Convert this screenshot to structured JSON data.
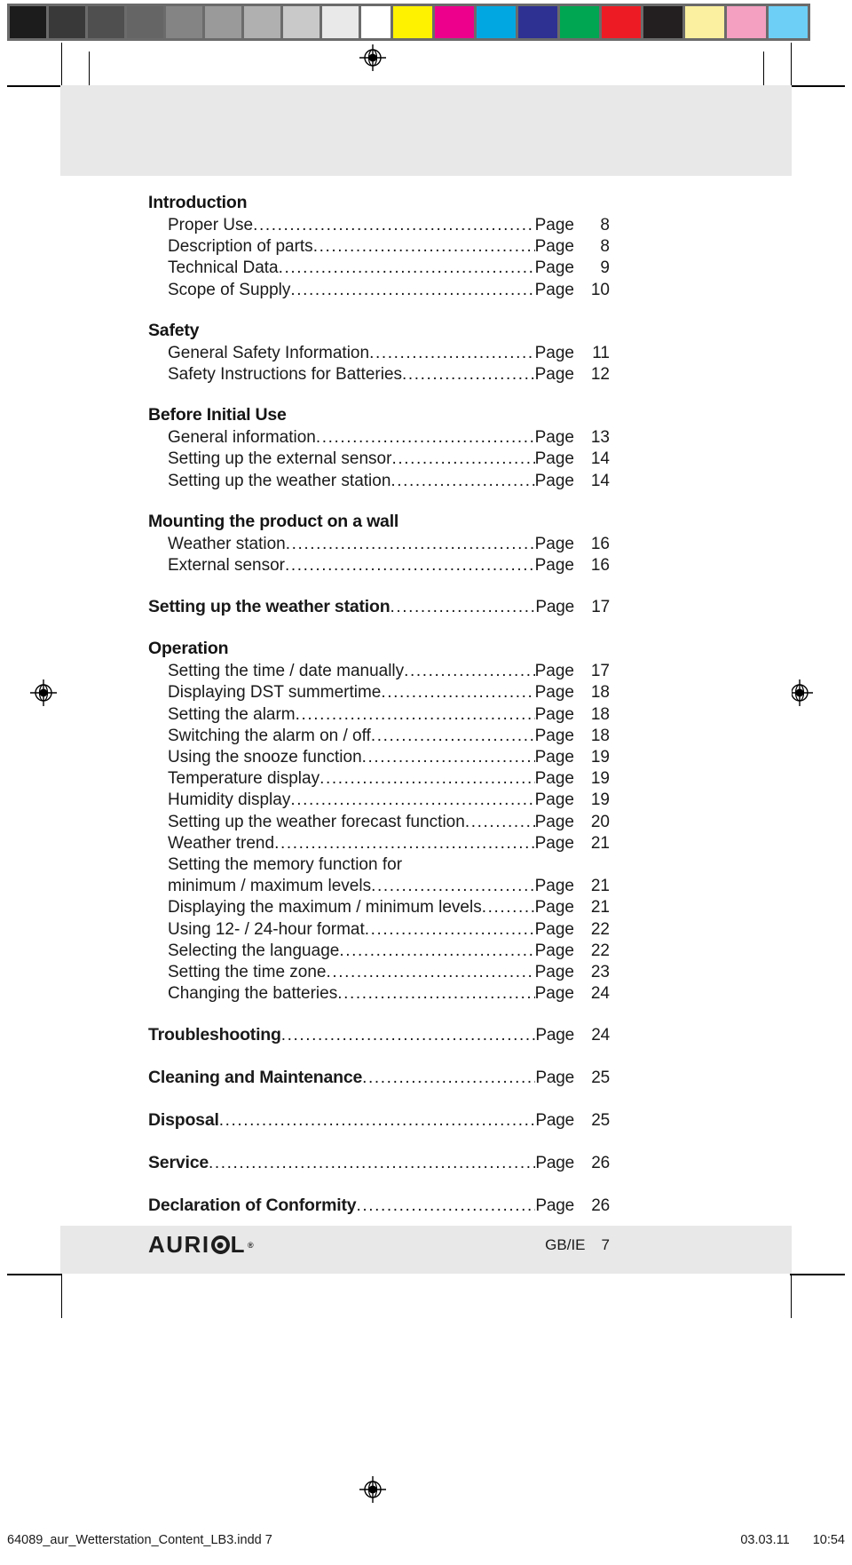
{
  "calibration": {
    "grayscale_patches": [
      "#1c1c1c",
      "#393939",
      "#4f4f4f",
      "#656565",
      "#848484",
      "#9a9a9a",
      "#b0b0b0",
      "#c9c9c9",
      "#e9e9e9",
      "#ffffff"
    ],
    "color_patches": [
      "#fff200",
      "#ec008c",
      "#00a7e1",
      "#2e3192",
      "#00a651",
      "#ed1c24",
      "#231f20",
      "#fbf0a0",
      "#f4a0c0",
      "#6dcff6"
    ],
    "strip_background": "#6b6b6b"
  },
  "toc": {
    "sections": [
      {
        "heading": "Introduction",
        "entries": [
          {
            "label": "Proper Use",
            "page_word": "Page",
            "page": "8"
          },
          {
            "label": "Description of parts",
            "page_word": "Page",
            "page": "8"
          },
          {
            "label": "Technical Data",
            "page_word": "Page",
            "page": "9"
          },
          {
            "label": "Scope of Supply",
            "page_word": "Page",
            "page": "10"
          }
        ]
      },
      {
        "heading": "Safety",
        "entries": [
          {
            "label": "General Safety Information",
            "page_word": "Page",
            "page": "11"
          },
          {
            "label": "Safety Instructions for Batteries",
            "page_word": "Page",
            "page": "12"
          }
        ]
      },
      {
        "heading": "Before Initial Use",
        "entries": [
          {
            "label": "General information",
            "page_word": "Page",
            "page": "13"
          },
          {
            "label": "Setting up the external sensor",
            "page_word": "Page",
            "page": "14"
          },
          {
            "label": "Setting up the weather station",
            "page_word": "Page",
            "page": "14"
          }
        ]
      },
      {
        "heading": "Mounting the product on a wall",
        "entries": [
          {
            "label": "Weather station",
            "page_word": "Page",
            "page": "16"
          },
          {
            "label": "External sensor",
            "page_word": "Page",
            "page": "16"
          }
        ]
      },
      {
        "heading_row": {
          "label": "Setting up the weather station",
          "page_word": "Page",
          "page": "17"
        },
        "entries": []
      },
      {
        "heading": "Operation",
        "entries": [
          {
            "label": "Setting the time / date manually",
            "page_word": "Page",
            "page": "17"
          },
          {
            "label": "Displaying DST summertime",
            "page_word": "Page",
            "page": "18"
          },
          {
            "label": "Setting the alarm",
            "page_word": "Page",
            "page": "18"
          },
          {
            "label": "Switching the alarm on / off",
            "page_word": "Page",
            "page": "18"
          },
          {
            "label": "Using the snooze function",
            "page_word": "Page",
            "page": "19"
          },
          {
            "label": "Temperature display",
            "page_word": "Page",
            "page": "19"
          },
          {
            "label": "Humidity display",
            "page_word": "Page",
            "page": "19"
          },
          {
            "label": "Setting up the weather forecast function",
            "page_word": "Page",
            "page": "20"
          },
          {
            "label": "Weather trend",
            "page_word": "Page",
            "page": "21"
          },
          {
            "label": "Setting the memory function for",
            "continuation": true
          },
          {
            "label": "minimum / maximum levels",
            "page_word": "Page",
            "page": "21"
          },
          {
            "label": "Displaying the maximum / minimum levels",
            "page_word": "Page",
            "page": "21"
          },
          {
            "label": "Using 12- / 24-hour format",
            "page_word": "Page",
            "page": "22"
          },
          {
            "label": "Selecting the language",
            "page_word": "Page",
            "page": "22"
          },
          {
            "label": "Setting the time zone",
            "page_word": "Page",
            "page": "23"
          },
          {
            "label": "Changing the batteries",
            "page_word": "Page",
            "page": "24"
          }
        ]
      },
      {
        "heading_row": {
          "label": "Troubleshooting",
          "page_word": "Page",
          "page": "24"
        },
        "entries": []
      },
      {
        "heading_row": {
          "label": "Cleaning and Maintenance",
          "page_word": "Page",
          "page": "25"
        },
        "entries": []
      },
      {
        "heading_row": {
          "label": "Disposal",
          "page_word": "Page",
          "page": "25"
        },
        "entries": []
      },
      {
        "heading_row": {
          "label": "Service",
          "page_word": "Page",
          "page": "26"
        },
        "entries": []
      },
      {
        "heading_row": {
          "label": "Declaration of Conformity",
          "page_word": "Page",
          "page": "26"
        },
        "entries": []
      }
    ]
  },
  "footer": {
    "brand_part1": "AURI",
    "brand_part2": "L",
    "brand_registered": "®",
    "locale": "GB/IE",
    "page_number": "7"
  },
  "slug": {
    "filename": "64089_aur_Wetterstation_Content_LB3.indd   7",
    "date": "03.03.11",
    "time": "10:54"
  }
}
